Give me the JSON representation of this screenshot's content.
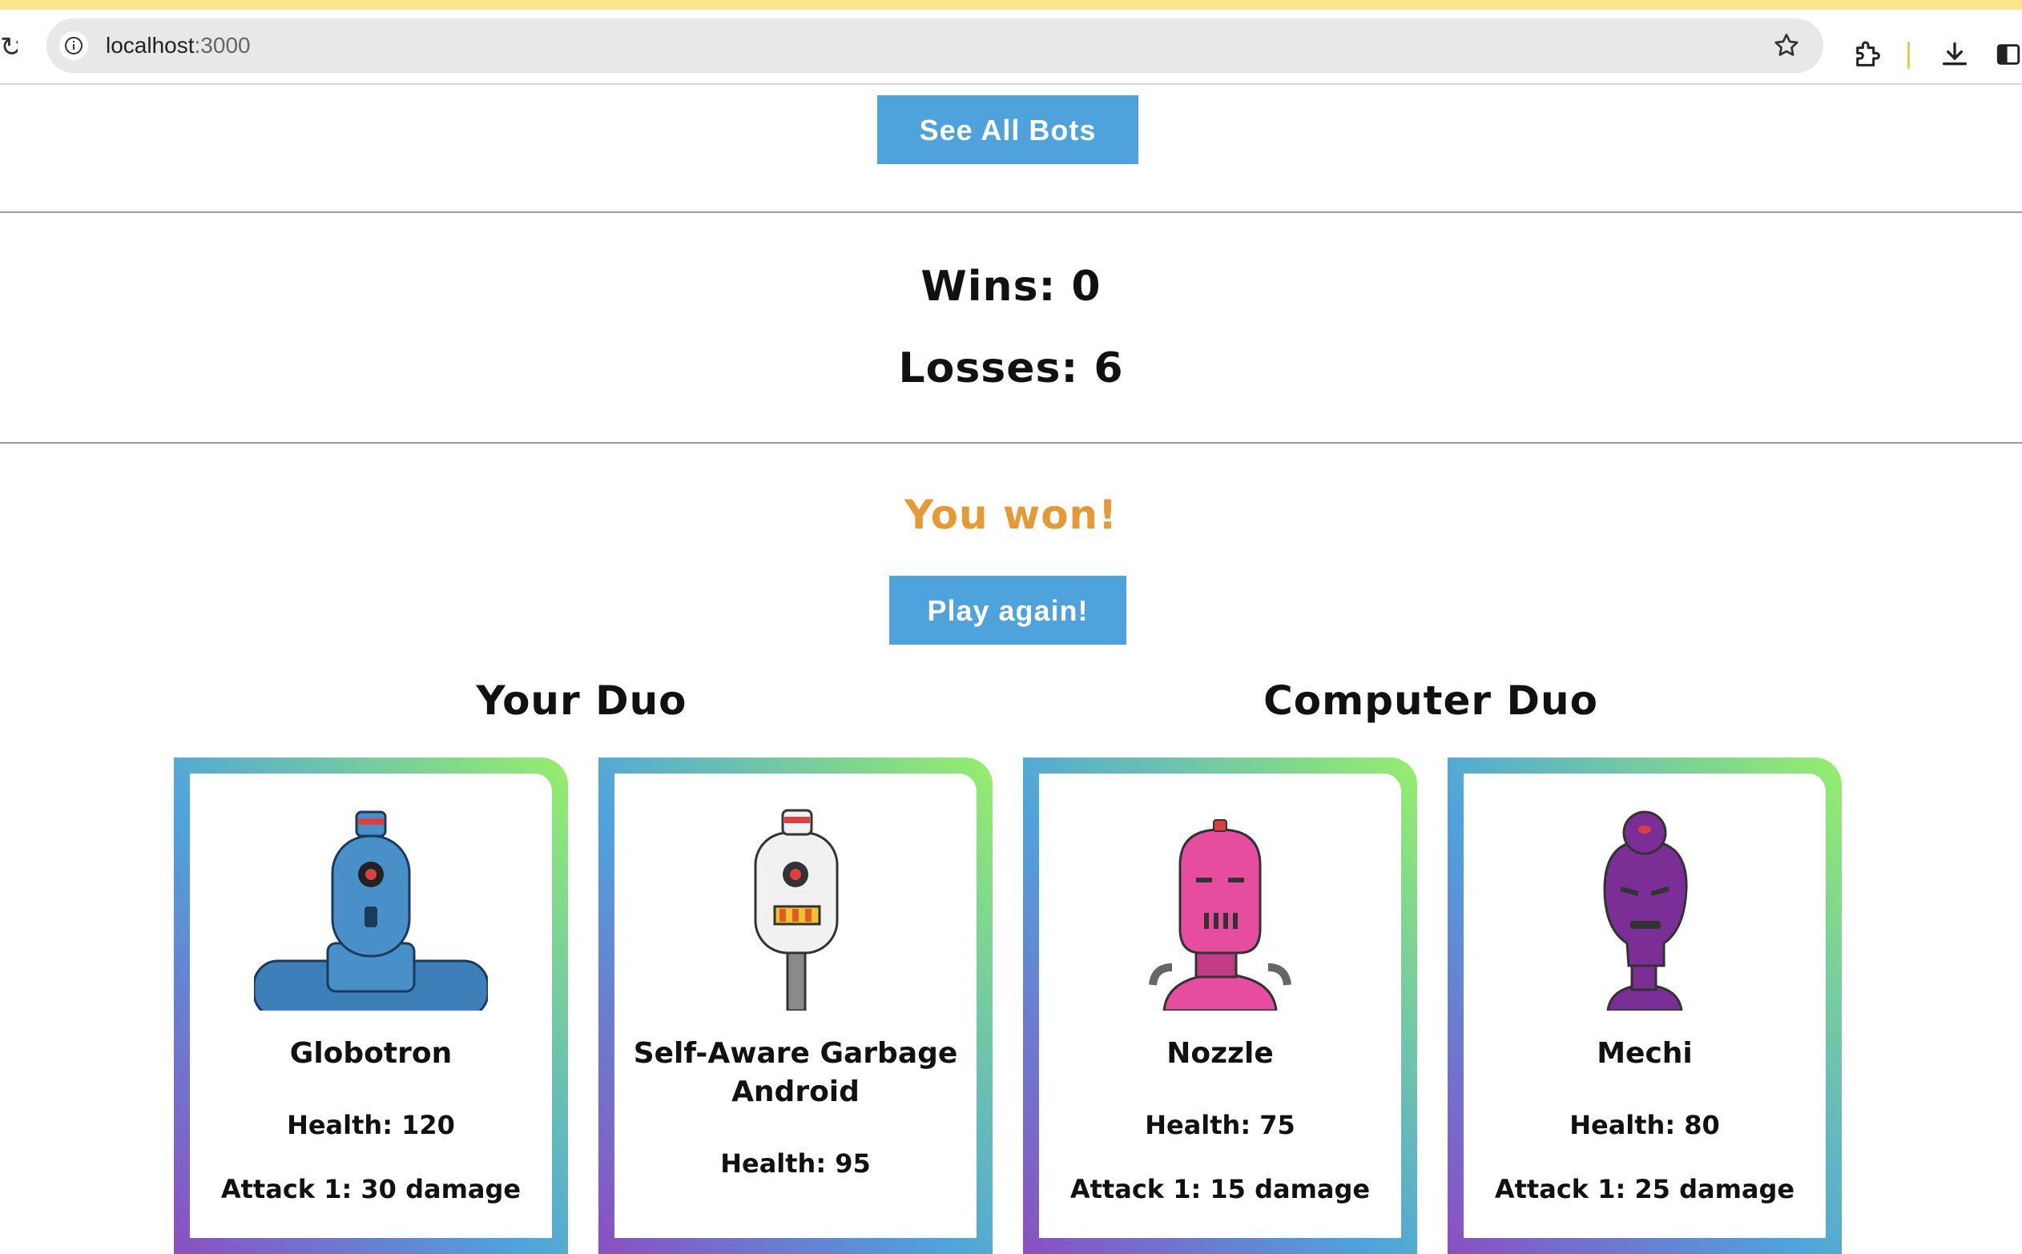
{
  "browser": {
    "url_host": "localhost",
    "url_port": ":3000"
  },
  "header": {
    "see_all_label": "See All Bots"
  },
  "record": {
    "wins_label": "Wins: 0",
    "losses_label": "Losses: 6"
  },
  "result": {
    "message": "You won!",
    "play_again_label": "Play again!"
  },
  "colors": {
    "button": "#4fa3dd",
    "result_text": "#e69a35"
  },
  "duos": {
    "yours": {
      "title": "Your Duo",
      "bots": [
        {
          "name": "Globotron",
          "health": "Health: 120",
          "attack": "Attack 1: 30 damage",
          "color": "#4a90c8"
        },
        {
          "name": "Self-Aware Garbage Android",
          "health": "Health: 95",
          "attack": "",
          "color": "#f1f1f1"
        }
      ]
    },
    "computer": {
      "title": "Computer Duo",
      "bots": [
        {
          "name": "Nozzle",
          "health": "Health: 75",
          "attack": "Attack 1: 15 damage",
          "color": "#e64d9f"
        },
        {
          "name": "Mechi",
          "health": "Health: 80",
          "attack": "Attack 1: 25 damage",
          "color": "#7b2e96"
        }
      ]
    }
  }
}
